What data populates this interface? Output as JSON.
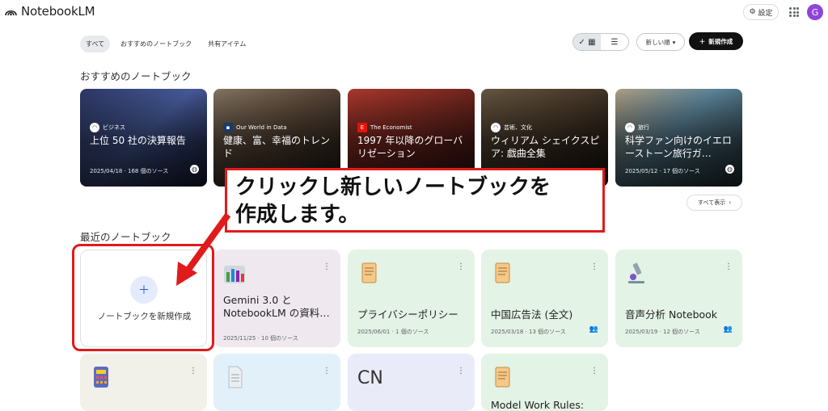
{
  "app": {
    "name": "NotebookLM"
  },
  "header": {
    "settings_label": "設定",
    "avatar_initial": "G"
  },
  "tabs": [
    {
      "label": "すべて",
      "active": true
    },
    {
      "label": "おすすめのノートブック",
      "active": false
    },
    {
      "label": "共有アイテム",
      "active": false
    }
  ],
  "toolbar": {
    "view_grid_selected": true,
    "sort_label": "新しい順",
    "new_label": "新規作成"
  },
  "featured": {
    "title": "おすすめのノートブック",
    "show_all": "すべて表示",
    "items": [
      {
        "source": "ビジネス",
        "title": "上位 50 社の決算報告",
        "meta": "2025/04/18 · 168 個のソース"
      },
      {
        "source": "Our World in Data",
        "title": "健康、富、幸福のトレンド",
        "meta": ""
      },
      {
        "source": "The Economist",
        "title": "1997 年以降のグローバリゼーション",
        "meta": ""
      },
      {
        "source": "芸術、文化",
        "title": "ウィリアム シェイクスピア: 戯曲全集",
        "meta": ""
      },
      {
        "source": "旅行",
        "title": "科学ファン向けのイエローストーン旅行ガ…",
        "meta": "2025/05/12 · 17 個のソース"
      }
    ]
  },
  "recent": {
    "title": "最近のノートブック",
    "new_card_label": "ノートブックを新規作成",
    "cards": [
      {
        "icon": "chart-icon",
        "title": "Gemini 3.0 と NotebookLM の資料…",
        "meta": "2025/11/25 · 10 個のソース",
        "shared": false,
        "color": "#efe9ef"
      },
      {
        "icon": "scroll-icon",
        "title": "プライバシーポリシー",
        "meta": "2025/06/01 · 1 個のソース",
        "shared": false,
        "color": "#e3f3e6"
      },
      {
        "icon": "scroll-icon",
        "title": "中国広告法 (全文)",
        "meta": "2025/03/18 · 13 個のソース",
        "shared": true,
        "color": "#e3f3e6"
      },
      {
        "icon": "microscope-icon",
        "title": "音声分析 Notebook",
        "meta": "2025/03/19 · 12 個のソース",
        "shared": true,
        "color": "#e3f3e6"
      },
      {
        "icon": "calculator-icon",
        "title": "",
        "meta": "",
        "shared": false,
        "color": "#f1f1ea"
      },
      {
        "icon": "document-icon",
        "title": "",
        "meta": "",
        "shared": false,
        "color": "#e2f1f9"
      },
      {
        "icon": "cn-text",
        "title": "",
        "meta": "",
        "shared": false,
        "color": "#e9ebf8",
        "badge": "CN"
      },
      {
        "icon": "scroll-icon",
        "title": "Model Work Rules:",
        "meta": "",
        "shared": false,
        "color": "#e3f3e6"
      }
    ]
  },
  "annotation": {
    "line1": "クリックし新しいノートブックを",
    "line2": "作成します。"
  },
  "colors": {
    "accent_red": "#e01b1b",
    "primary_dark": "#111111",
    "new_plus_bg": "#e3ebfd"
  }
}
